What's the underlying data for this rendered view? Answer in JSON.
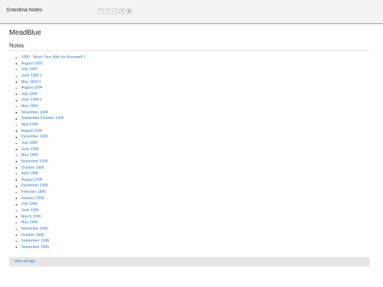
{
  "header": {
    "app_title": "Grandma Notes",
    "toolbar": [
      {
        "icon": "text-icon",
        "glyph": "T"
      },
      {
        "icon": "search-icon",
        "glyph": "⚲"
      },
      {
        "icon": "shuffle-icon",
        "glyph": "⤨"
      },
      {
        "icon": "copy-icon",
        "glyph": "⧉"
      },
      {
        "icon": "grid-icon",
        "glyph": "▦"
      }
    ]
  },
  "main": {
    "notebook_title": "MeadBlue",
    "section_heading": "Notes",
    "notes": [
      "1990 - Music Tour With Iris Brumwell 1",
      "August 1993",
      "July 1993",
      "June 1993 1",
      "May 1993 1",
      "August 1994",
      "July 1994",
      "June 1994 1",
      "May 1994",
      "November 1994",
      "September-October 1994",
      "April 1995",
      "August 1995",
      "December 1995",
      "July 1995",
      "June 1995",
      "May 1995",
      "November 1995",
      "October 1995",
      "April 1996",
      "August 1996",
      "December 1996",
      "February 1996",
      "January 1996",
      "July 1996",
      "June 1996",
      "March 1996",
      "May 1996",
      "November 1996",
      "October 1996",
      "September 1996",
      "September 1995"
    ],
    "view_all_label": "View all tags"
  },
  "colors": {
    "link": "#2e7bcf",
    "topbar_bg": "#f3f3f3",
    "footer_bar_bg": "#e5e5e5"
  }
}
